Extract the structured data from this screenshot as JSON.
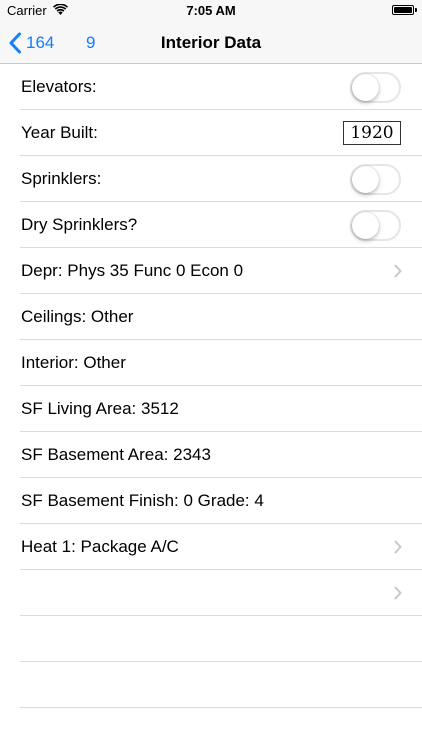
{
  "status_bar": {
    "carrier": "Carrier",
    "time": "7:05 AM"
  },
  "nav": {
    "back_label": "164",
    "secondary_label": "9",
    "title": "Interior Data"
  },
  "rows": [
    {
      "label": "Elevators:",
      "accessory": "toggle",
      "on": false
    },
    {
      "label": "Year Built:",
      "accessory": "field",
      "value": "1920"
    },
    {
      "label": "Sprinklers:",
      "accessory": "toggle",
      "on": false
    },
    {
      "label": "Dry Sprinklers?",
      "accessory": "toggle",
      "on": false
    },
    {
      "label": "Depr: Phys 35 Func 0 Econ 0",
      "accessory": "chevron"
    },
    {
      "label": "Ceilings: Other",
      "accessory": "none"
    },
    {
      "label": "Interior: Other",
      "accessory": "none"
    },
    {
      "label": "SF Living Area: 3512",
      "accessory": "none"
    },
    {
      "label": "SF Basement Area: 2343",
      "accessory": "none"
    },
    {
      "label": "SF Basement Finish: 0 Grade: 4",
      "accessory": "none"
    },
    {
      "label": "Heat 1: Package A/C",
      "accessory": "chevron"
    },
    {
      "label": "",
      "accessory": "chevron"
    },
    {
      "label": "",
      "accessory": "none"
    },
    {
      "label": "",
      "accessory": "none"
    }
  ],
  "colors": {
    "accent": "#147efb",
    "separator": "#dcdcdf",
    "toggle_off_border": "#e5e5ea",
    "chevron": "#c7c7cc"
  }
}
